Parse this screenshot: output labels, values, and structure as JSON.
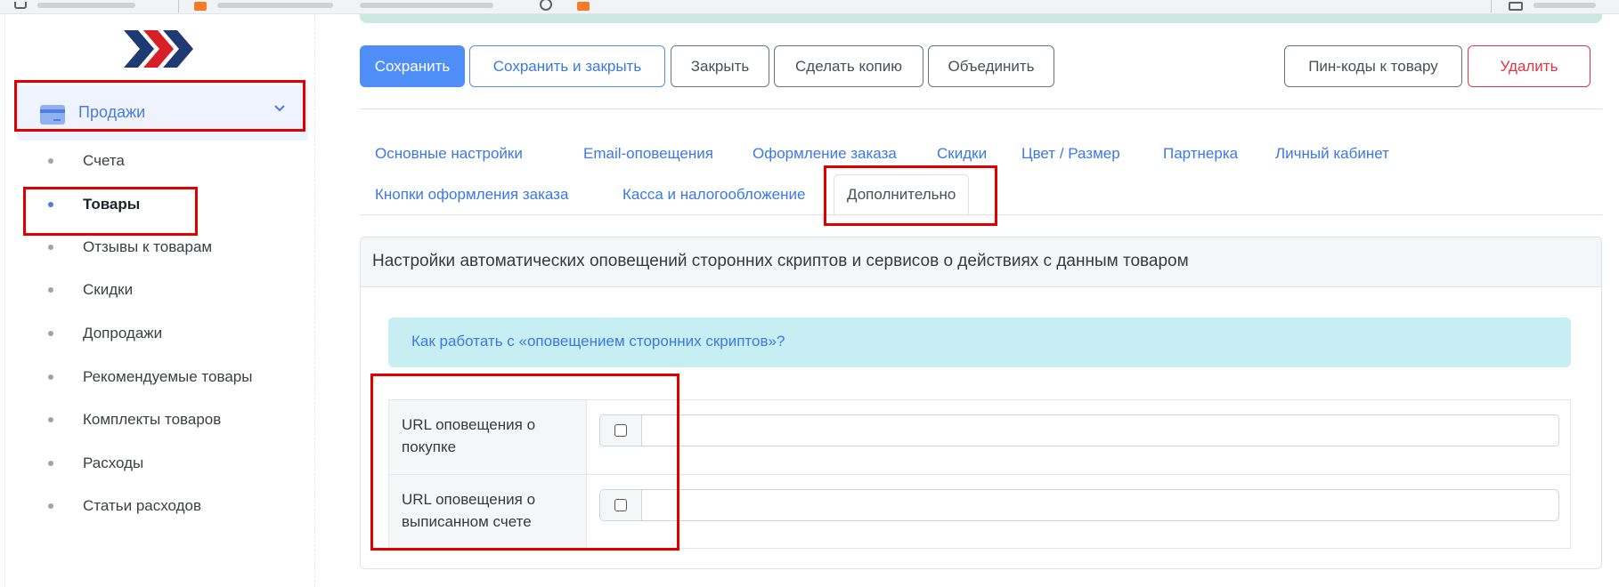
{
  "colors": {
    "accent": "#4f8ef7",
    "link": "#3b78e7",
    "danger": "#dc3545",
    "highlight": "#e00000",
    "info_bg": "#c6eef3"
  },
  "sidebar": {
    "logo_icon": "chevrons-logo",
    "section": {
      "icon": "credit-card-icon",
      "label": "Продажи",
      "chevron": "chevron-down-icon"
    },
    "items": [
      {
        "label": "Счета",
        "active": false
      },
      {
        "label": "Товары",
        "active": true
      },
      {
        "label": "Отзывы к товарам",
        "active": false
      },
      {
        "label": "Скидки",
        "active": false
      },
      {
        "label": "Допродажи",
        "active": false
      },
      {
        "label": "Рекомендуемые товары",
        "active": false
      },
      {
        "label": "Комплекты товаров",
        "active": false
      },
      {
        "label": "Расходы",
        "active": false
      },
      {
        "label": "Статьи расходов",
        "active": false
      }
    ]
  },
  "toolbar": {
    "save": "Сохранить",
    "save_close": "Сохранить и закрыть",
    "close": "Закрыть",
    "copy": "Сделать копию",
    "merge": "Объединить",
    "pins": "Пин-коды к товару",
    "delete": "Удалить"
  },
  "tabs": [
    "Основные настройки",
    "Email-оповещения",
    "Оформление заказа",
    "Скидки",
    "Цвет / Размер",
    "Партнерка",
    "Личный кабинет",
    "Кнопки оформления заказа",
    "Касса и налогообложение",
    "Дополнительно"
  ],
  "active_tab": "Дополнительно",
  "card": {
    "title": "Настройки автоматических оповещений сторонних скриптов и сервисов о действиях с данным товаром",
    "help_link": "Как работать с «оповещением сторонних скриптов»?",
    "rows": [
      {
        "label": "URL оповещения о покупке",
        "checked": false,
        "value": ""
      },
      {
        "label": "URL оповещения о выписанном счете",
        "checked": false,
        "value": ""
      }
    ]
  }
}
